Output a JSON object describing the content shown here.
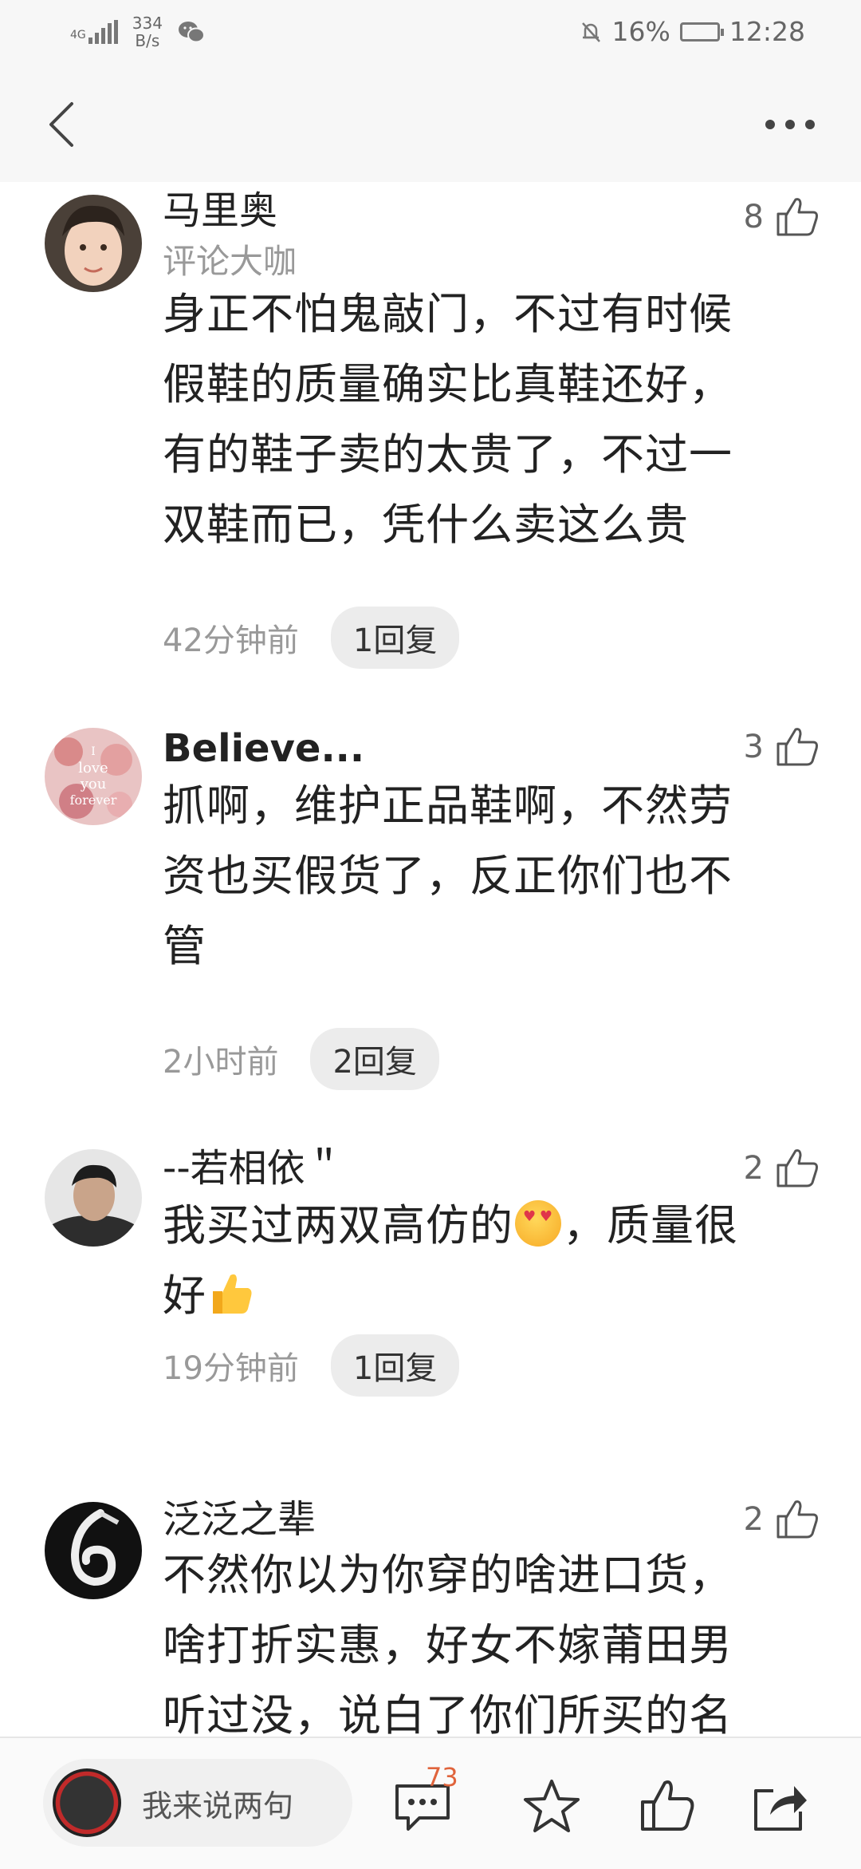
{
  "status_bar": {
    "network": "4G",
    "speed_value": "334",
    "speed_unit": "B/s",
    "battery": "16%",
    "time": "12:28"
  },
  "comments": [
    {
      "username": "马里奥",
      "badge": "评论大咖",
      "likes": "8",
      "lines": [
        "身正不怕鬼敲门，不过有时候",
        "假鞋的质量确实比真鞋还好，",
        "有的鞋子卖的太贵了，不过一",
        "双鞋而已，凭什么卖这么贵"
      ],
      "time": "42分钟前",
      "replies": "1回复"
    },
    {
      "username": "Believe...",
      "likes": "3",
      "avatar_text": [
        "I",
        "love",
        "you",
        "forever"
      ],
      "lines": [
        "抓啊，维护正品鞋啊，不然劳",
        "资也买假货了，反正你们也不",
        "管"
      ],
      "time": "2小时前",
      "replies": "2回复"
    },
    {
      "username": "--若相依＂",
      "likes": "2",
      "line1": "我买过两双高仿的",
      "line1_tail": "，质量很",
      "line2": "好",
      "time": "19分钟前",
      "replies": "1回复"
    },
    {
      "username": "泛泛之辈",
      "likes": "2",
      "lines": [
        "不然你以为你穿的啥进口货，",
        "啥打折实惠，好女不嫁莆田男",
        "听过没，说白了你们所买的名"
      ]
    }
  ],
  "bottom_bar": {
    "input_placeholder": "我来说两句",
    "comment_count": "73"
  },
  "colors": {
    "accent": "#e0643c",
    "reply_pill_bg": "#ececec",
    "muted_text": "#999999",
    "bar_bg": "#f7f7f7"
  },
  "icons": [
    "signal-icon",
    "wechat-icon",
    "mute-bell-icon",
    "battery-icon",
    "back-icon",
    "more-icon",
    "thumb-up-icon",
    "comment-icon",
    "star-icon",
    "share-icon"
  ]
}
